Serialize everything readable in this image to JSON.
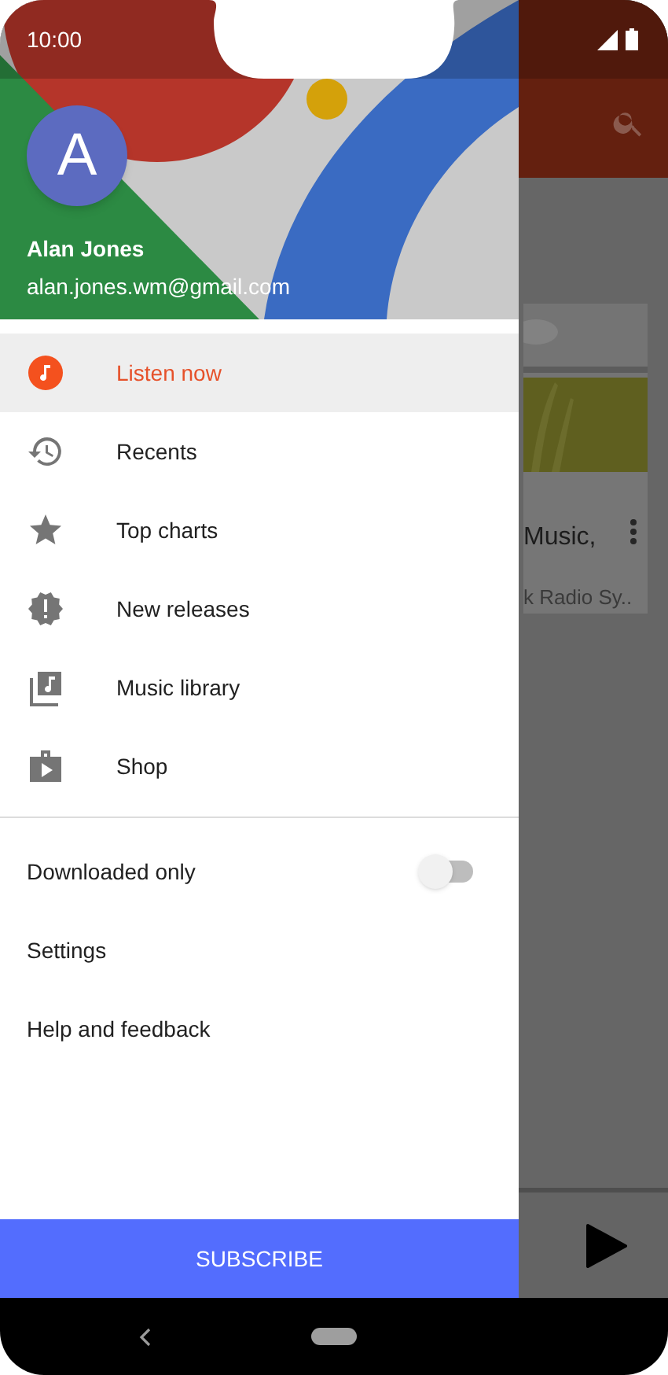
{
  "status_bar": {
    "time": "10:00"
  },
  "account": {
    "avatar_letter": "A",
    "name": "Alan Jones",
    "email": "alan.jones.wm@gmail.com"
  },
  "nav_items": [
    {
      "label": "Listen now",
      "selected": true
    },
    {
      "label": "Recents",
      "selected": false
    },
    {
      "label": "Top charts",
      "selected": false
    },
    {
      "label": "New releases",
      "selected": false
    },
    {
      "label": "Music library",
      "selected": false
    },
    {
      "label": "Shop",
      "selected": false
    }
  ],
  "options": [
    {
      "kind": "toggle",
      "label": "Downloaded only",
      "on": false
    },
    {
      "kind": "link",
      "label": "Settings"
    },
    {
      "kind": "link",
      "label": "Help and feedback"
    }
  ],
  "subscribe_button": "SUBSCRIBE",
  "background": {
    "card": {
      "title": "Music,",
      "subtitle": "k Radio Sy.."
    }
  }
}
